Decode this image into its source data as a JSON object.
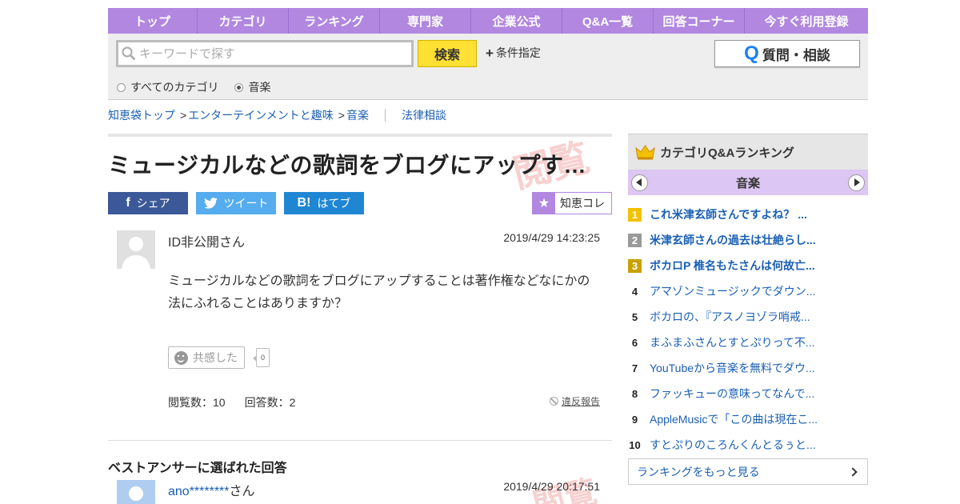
{
  "nav": {
    "items": [
      "トップ",
      "カテゴリ",
      "ランキング",
      "専門家",
      "企業公式",
      "Q&A一覧",
      "回答コーナー",
      "今すぐ利用登録"
    ]
  },
  "search": {
    "placeholder": "キーワードで探す",
    "value": "",
    "button_label": "検索",
    "condition_label": "条件指定",
    "ask_label": "質問・相談",
    "radio_all": "すべてのカテゴリ",
    "radio_music": "音楽",
    "selected": "音楽"
  },
  "breadcrumb": {
    "items": [
      "知恵袋トップ",
      "エンターテインメントと趣味",
      "音楽"
    ],
    "separator": ">",
    "legal": "法律相談"
  },
  "question": {
    "title": "ミュージカルなどの歌詞をブログにアップす…",
    "share": {
      "facebook": "シェア",
      "twitter": "ツイート",
      "hatena": "はてブ"
    },
    "chiecolle": "知恵コレ",
    "user": "ID非公開さん",
    "date": "2019/4/29 14:23:25",
    "body": "ミュージカルなどの歌詞をブログにアップすることは著作権などなにかの法にふれることはありますか？",
    "empathy_label": "共感した",
    "empathy_count": "0",
    "views": "閲覧数：10",
    "answers": "回答数：2",
    "report": "違反報告"
  },
  "best_answer": {
    "label": "ベストアンサーに選ばれた回答",
    "user_name": "ano********",
    "user_suffix": "さん",
    "date": "2019/4/29 20:17:51"
  },
  "sidebar": {
    "title": "カテゴリQ&Aランキング",
    "category": "音楽",
    "ranking": [
      {
        "rank": "1",
        "text": "これ米津玄師さんですよね？ ..."
      },
      {
        "rank": "2",
        "text": "米津玄師さんの過去は壮絶らし..."
      },
      {
        "rank": "3",
        "text": "ボカロP 椎名もたさんは何故亡..."
      },
      {
        "rank": "4",
        "text": "アマゾンミュージックでダウン..."
      },
      {
        "rank": "5",
        "text": "ボカロの、『アスノヨゾラ哨戒..."
      },
      {
        "rank": "6",
        "text": "まふまふさんとすとぷりって不..."
      },
      {
        "rank": "7",
        "text": "YouTubeから音楽を無料でダウ..."
      },
      {
        "rank": "8",
        "text": "ファッキューの意味ってなんで..."
      },
      {
        "rank": "9",
        "text": "AppleMusicで「この曲は現在こ..."
      },
      {
        "rank": "10",
        "text": "すとぷりのころんくんとるぅと..."
      }
    ],
    "more": "ランキングをもっと見る"
  },
  "colors": {
    "nav": "#b187e0",
    "search_button": "#ffe033",
    "link": "#1a5fb4",
    "facebook": "#3b5998",
    "twitter": "#55acee",
    "hatena": "#1f86d3"
  }
}
